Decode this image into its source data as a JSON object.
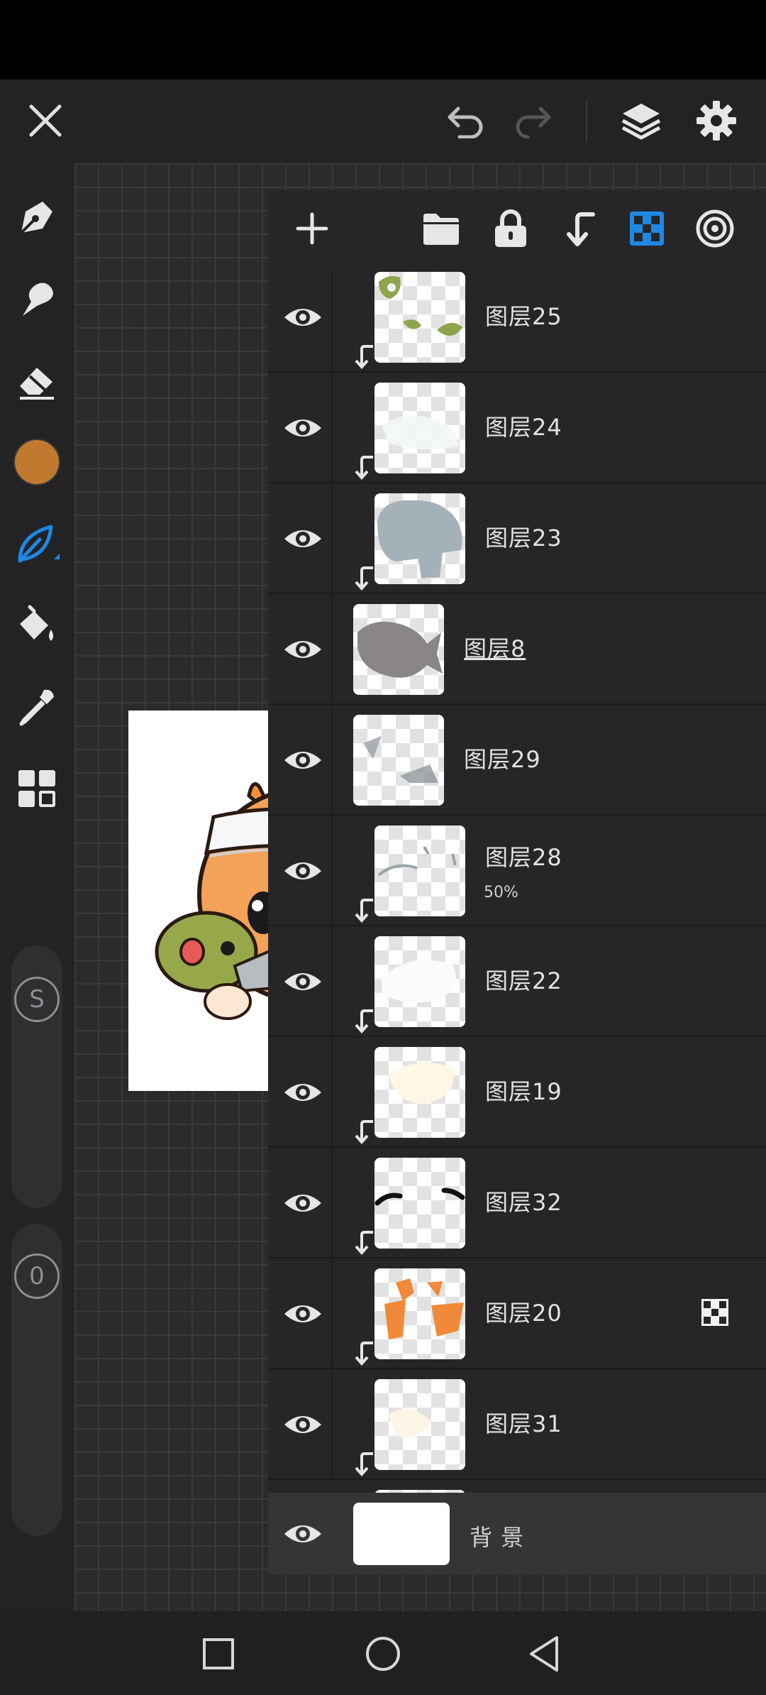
{
  "layers_panel": {
    "layers": [
      {
        "name": "图层25",
        "opacity": "",
        "clipped": true,
        "selected": false,
        "alpha_locked": false,
        "thumb": "green-leaves"
      },
      {
        "name": "图层24",
        "opacity": "",
        "clipped": true,
        "selected": false,
        "alpha_locked": false,
        "thumb": "faint-cloud"
      },
      {
        "name": "图层23",
        "opacity": "",
        "clipped": true,
        "selected": false,
        "alpha_locked": false,
        "thumb": "grey-blue-shape"
      },
      {
        "name": "图层8",
        "opacity": "",
        "clipped": false,
        "selected": true,
        "alpha_locked": false,
        "thumb": "grey-fish"
      },
      {
        "name": "图层29",
        "opacity": "",
        "clipped": false,
        "selected": false,
        "alpha_locked": false,
        "thumb": "grey-shards"
      },
      {
        "name": "图层28",
        "opacity": "50%",
        "clipped": true,
        "selected": false,
        "alpha_locked": false,
        "thumb": "faint-strokes"
      },
      {
        "name": "图层22",
        "opacity": "",
        "clipped": true,
        "selected": false,
        "alpha_locked": false,
        "thumb": "white-blob"
      },
      {
        "name": "图层19",
        "opacity": "",
        "clipped": true,
        "selected": false,
        "alpha_locked": false,
        "thumb": "cream-blob"
      },
      {
        "name": "图层32",
        "opacity": "",
        "clipped": true,
        "selected": false,
        "alpha_locked": false,
        "thumb": "black-brows"
      },
      {
        "name": "图层20",
        "opacity": "",
        "clipped": true,
        "selected": false,
        "alpha_locked": true,
        "thumb": "orange-patches"
      },
      {
        "name": "图层31",
        "opacity": "",
        "clipped": true,
        "selected": false,
        "alpha_locked": false,
        "thumb": "faint-cream"
      }
    ],
    "background_layer": {
      "name": "背 景"
    }
  },
  "toolbar": {
    "brush_size_label": "S",
    "opacity_label": "0",
    "current_color": "#c07a2f"
  },
  "colors": {
    "accent": "#1e88e5",
    "panel": "#262628",
    "toolbar": "#232325"
  }
}
